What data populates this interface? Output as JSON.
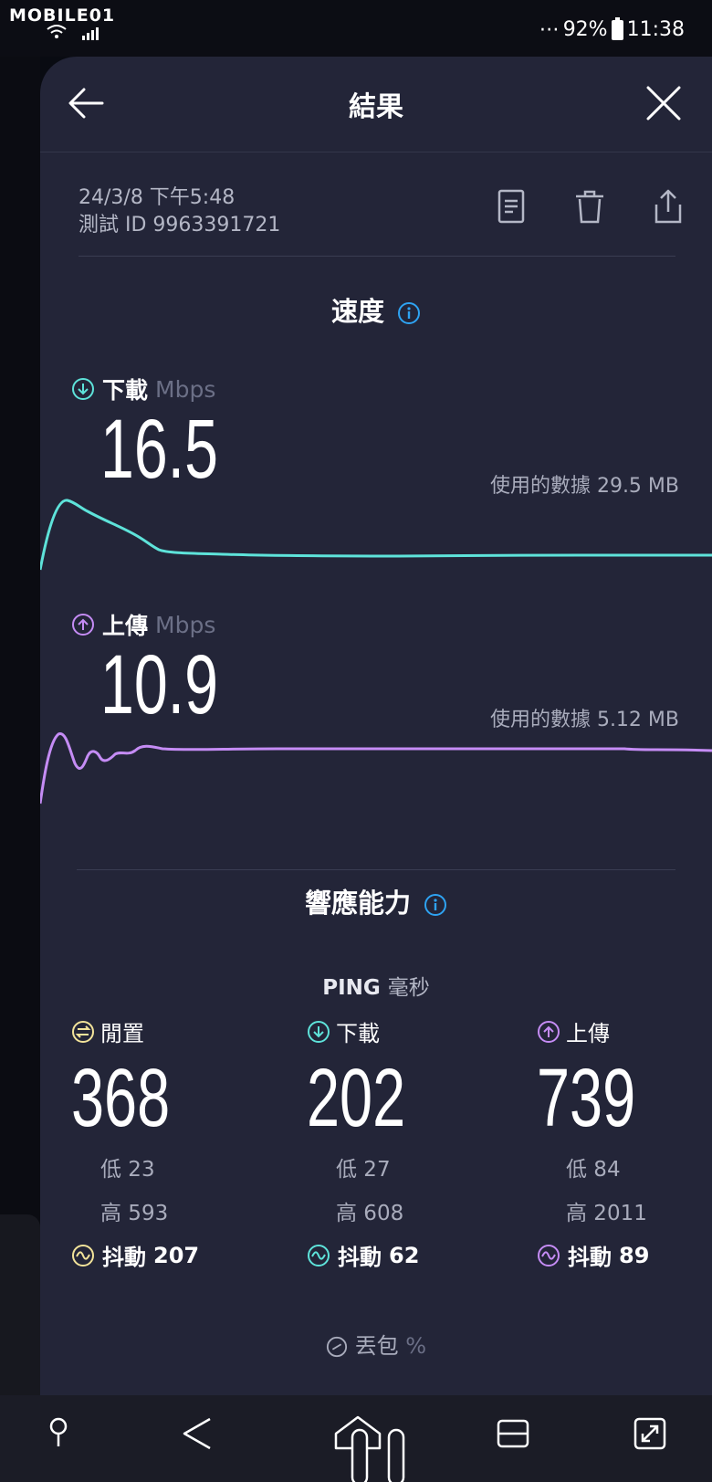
{
  "status": {
    "logo": "MOBILE01",
    "battery": "92%",
    "time": "11:38",
    "dots": "⋯"
  },
  "header": {
    "title": "結果"
  },
  "meta": {
    "date": "24/3/8 下午5:48",
    "test_id": "測試 ID 9963391721"
  },
  "speed": {
    "title": "速度",
    "download": {
      "label": "下載",
      "unit": "Mbps",
      "value": "16.5",
      "data_used": "使用的數據 29.5 MB"
    },
    "upload": {
      "label": "上傳",
      "unit": "Mbps",
      "value": "10.9",
      "data_used": "使用的數據 5.12 MB"
    }
  },
  "responsiveness": {
    "title": "響應能力",
    "ping_label": "PING",
    "ping_unit": "毫秒",
    "idle": {
      "label": "閒置",
      "value": "368",
      "low": "低 23",
      "high": "高 593",
      "jitter_label": "抖動",
      "jitter": "207"
    },
    "download": {
      "label": "下載",
      "value": "202",
      "low": "低 27",
      "high": "高 608",
      "jitter_label": "抖動",
      "jitter": "62"
    },
    "upload": {
      "label": "上傳",
      "value": "739",
      "low": "低 84",
      "high": "高 2011",
      "jitter_label": "抖動",
      "jitter": "89"
    }
  },
  "packet_loss": {
    "label": "丟包",
    "unit": "%"
  },
  "colors": {
    "download": "#5ee3da",
    "upload": "#c58cf5",
    "idle": "#f2e39a",
    "info": "#2ea3f2",
    "sheet": "#232538"
  }
}
